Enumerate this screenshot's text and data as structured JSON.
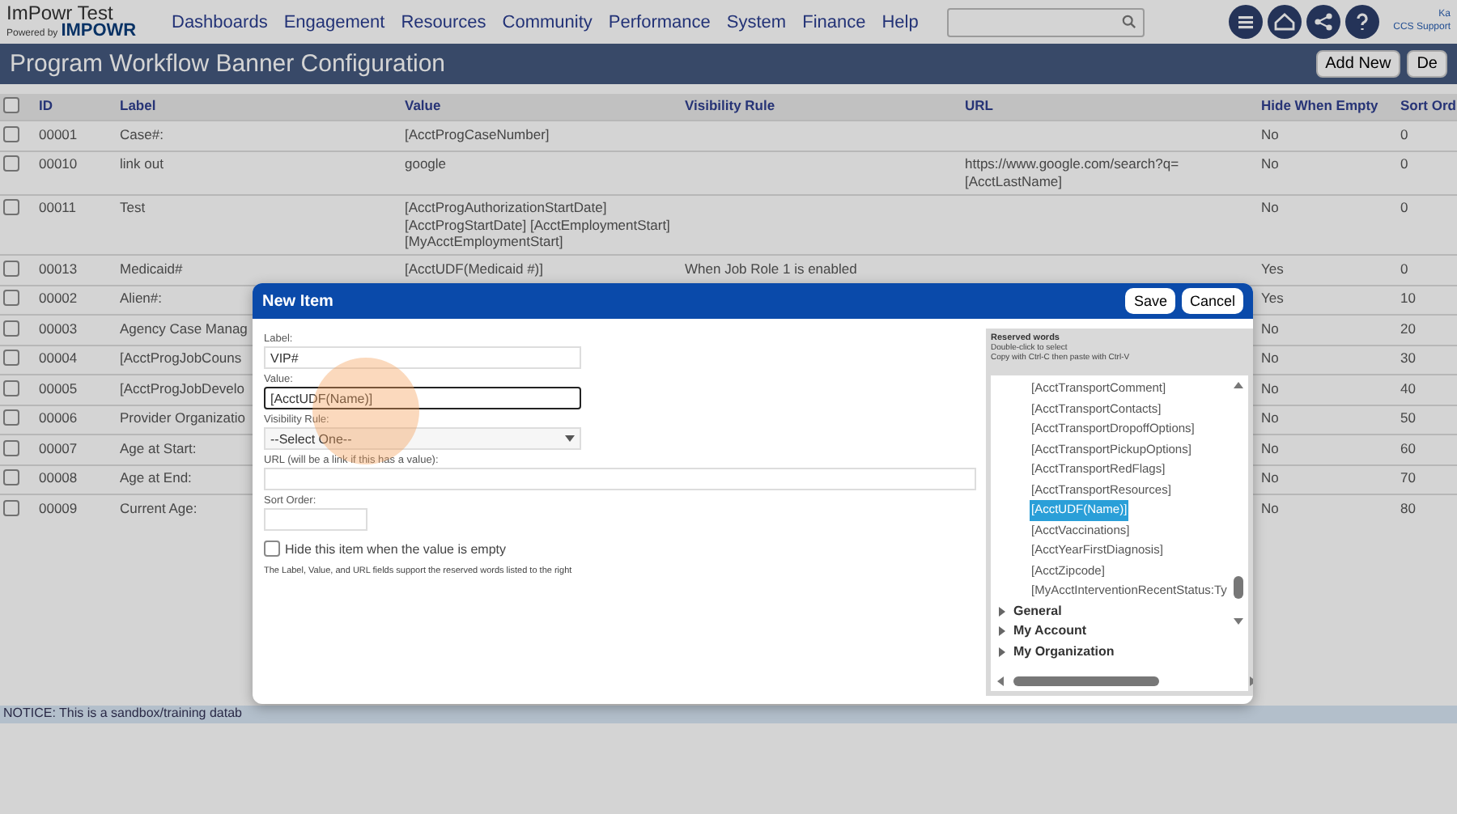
{
  "app": {
    "name": "ImPowr Test",
    "powered_by": "Powered by",
    "brand": "IMPOWR",
    "user": "Ka",
    "org": "CCS Support"
  },
  "nav": [
    "Dashboards",
    "Engagement",
    "Resources",
    "Community",
    "Performance",
    "System",
    "Finance",
    "Help"
  ],
  "page_title": "Program Workflow Banner Configuration",
  "page_buttons": [
    "Add New",
    "De"
  ],
  "table": {
    "all_checked": false,
    "columns": [
      "ID",
      "Label",
      "Value",
      "Visibility Rule",
      "URL",
      "Hide When Empty",
      "Sort Ord"
    ],
    "rows": [
      {
        "checked": false,
        "cells": [
          "00001",
          "Case#:",
          "[AcctProgCaseNumber]",
          "",
          "",
          "No",
          "0"
        ]
      },
      {
        "checked": false,
        "cells": [
          "00010",
          "link out",
          "google",
          "",
          "https://www.google.com/search?q=\n[AcctLastName]",
          "No",
          "0"
        ]
      },
      {
        "checked": false,
        "cells": [
          "00011",
          "Test",
          "[AcctProgAuthorizationStartDate]\n[AcctProgStartDate] [AcctEmploymentStart]\n[MyAcctEmploymentStart]",
          "",
          "",
          "No",
          "0"
        ]
      },
      {
        "checked": false,
        "cells": [
          "00013",
          "Medicaid#",
          "[AcctUDF(Medicaid #)]",
          "When Job Role 1 is enabled",
          "",
          "Yes",
          "0"
        ]
      },
      {
        "checked": false,
        "cells": [
          "00002",
          "Alien#:",
          "",
          "",
          "",
          "Yes",
          "10"
        ]
      },
      {
        "checked": false,
        "cells": [
          "00003",
          "Agency Case Manag",
          "",
          "",
          "",
          "No",
          "20"
        ]
      },
      {
        "checked": false,
        "cells": [
          "00004",
          "[AcctProgJobCouns",
          "",
          "",
          "",
          "No",
          "30"
        ]
      },
      {
        "checked": false,
        "cells": [
          "00005",
          "[AcctProgJobDevelo",
          "",
          "",
          "",
          "No",
          "40"
        ]
      },
      {
        "checked": false,
        "cells": [
          "00006",
          "Provider Organizatio",
          "",
          "",
          "",
          "No",
          "50"
        ]
      },
      {
        "checked": false,
        "cells": [
          "00007",
          "Age at Start:",
          "",
          "",
          "",
          "No",
          "60"
        ]
      },
      {
        "checked": false,
        "cells": [
          "00008",
          "Age at End:",
          "",
          "",
          "",
          "No",
          "70"
        ]
      },
      {
        "checked": false,
        "cells": [
          "00009",
          "Current Age:",
          "",
          "",
          "",
          "No",
          "80"
        ]
      }
    ]
  },
  "notice": "NOTICE: This is a sandbox/training datab",
  "dialog": {
    "title": "New Item",
    "buttons": [
      "Save",
      "Cancel"
    ],
    "fields": [
      {
        "kind": "text",
        "label": "Label:",
        "value": "VIP#",
        "focused": false
      },
      {
        "kind": "text",
        "label": "Value:",
        "value": "[AcctUDF(Name)]",
        "focused": true
      },
      {
        "kind": "select",
        "label": "Visibility Rule:",
        "value": "--Select One--",
        "focused": false
      },
      {
        "kind": "url",
        "label": "URL (will be a link if this has a value):",
        "focused": false
      },
      {
        "kind": "number",
        "label": "Sort Order:",
        "focused": false
      }
    ],
    "hide_checkbox": {
      "label": "Hide this item when the value is empty",
      "checked": false
    },
    "hint": "The Label, Value, and URL fields support the reserved words listed to the right",
    "reserved": {
      "title": "Reserved words",
      "help": [
        "Double-click to select",
        "Copy with Ctrl-C then paste with Ctrl-V"
      ],
      "items": [
        {
          "text": "[AcctTransportComment]",
          "selected": false
        },
        {
          "text": "[AcctTransportContacts]",
          "selected": false
        },
        {
          "text": "[AcctTransportDropoffOptions]",
          "selected": false
        },
        {
          "text": "[AcctTransportPickupOptions]",
          "selected": false
        },
        {
          "text": "[AcctTransportRedFlags]",
          "selected": false
        },
        {
          "text": "[AcctTransportResources]",
          "selected": false
        },
        {
          "text": "[AcctUDF(Name)]",
          "selected": true
        },
        {
          "text": "[AcctVaccinations]",
          "selected": false
        },
        {
          "text": "[AcctYearFirstDiagnosis]",
          "selected": false
        },
        {
          "text": "[AcctZipcode]",
          "selected": false
        },
        {
          "text": "[MyAcctInterventionRecentStatus:Ty",
          "selected": false
        }
      ],
      "groups": [
        {
          "label": "General",
          "expanded": false
        },
        {
          "label": "My Account",
          "expanded": false
        },
        {
          "label": "My Organization",
          "expanded": false
        }
      ]
    }
  }
}
